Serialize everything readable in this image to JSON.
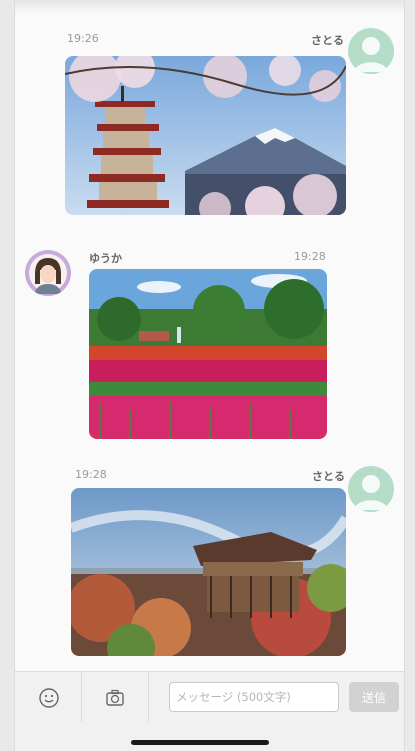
{
  "messages": [
    {
      "time": "19:26",
      "sender": "さとる",
      "image": "fuji-pagoda-cherry-blossom-photo"
    },
    {
      "time": "19:28",
      "sender": "ゆうか",
      "image": "tulip-field-photo"
    },
    {
      "time": "19:28",
      "sender": "さとる",
      "image": "kiyomizu-temple-autumn-photo"
    }
  ],
  "composer": {
    "emoji_icon": "smiley-icon",
    "camera_icon": "camera-icon",
    "input_placeholder": "メッセージ (500文字)",
    "send_label": "送信"
  },
  "colors": {
    "avatar_green": "#b4dcc6",
    "avatar_purple": "#c7a9dc",
    "send_disabled": "#d2d2d2"
  }
}
